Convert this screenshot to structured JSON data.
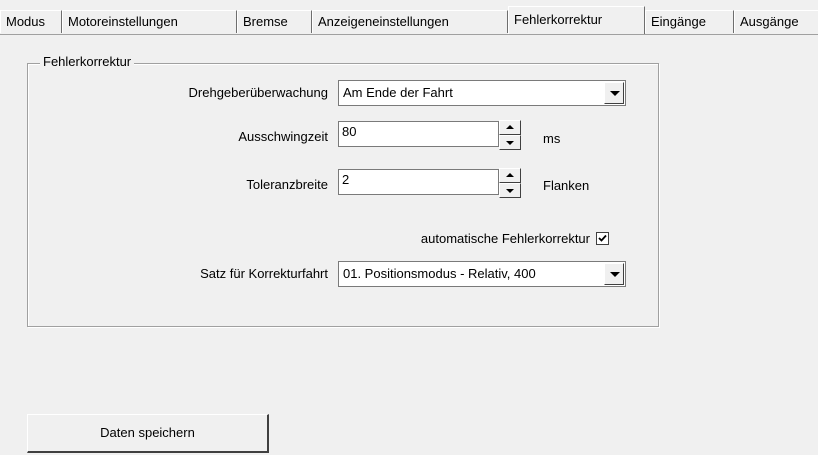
{
  "tabs": [
    {
      "label": "Modus",
      "active": false
    },
    {
      "label": "Motoreinstellungen",
      "active": false
    },
    {
      "label": "Bremse",
      "active": false
    },
    {
      "label": "Anzeigeneinstellungen",
      "active": false
    },
    {
      "label": "Fehlerkorrektur",
      "active": true
    },
    {
      "label": "Eingänge",
      "active": false
    },
    {
      "label": "Ausgänge",
      "active": false
    }
  ],
  "group": {
    "title": "Fehlerkorrektur",
    "encoder_monitoring": {
      "label": "Drehgeberüberwachung",
      "value": "Am Ende der Fahrt"
    },
    "settling_time": {
      "label": "Ausschwingzeit",
      "value": "80",
      "unit": "ms"
    },
    "tolerance_width": {
      "label": "Toleranzbreite",
      "value": "2",
      "unit": "Flanken"
    },
    "auto_correction": {
      "label": "automatische Fehlerkorrektur",
      "checked": true
    },
    "correction_record": {
      "label": "Satz für Korrekturfahrt",
      "value": "01. Positionsmodus - Relativ,  400"
    }
  },
  "save_button": {
    "label": "Daten speichern"
  }
}
